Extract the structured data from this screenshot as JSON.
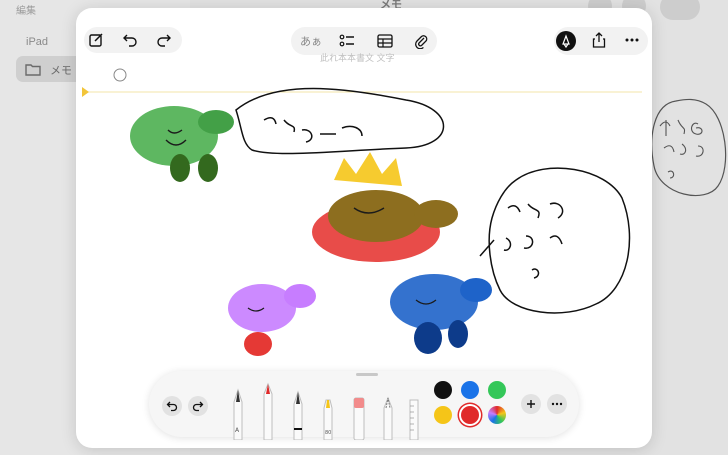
{
  "background": {
    "edit_label": "編集",
    "notes_title": "メモ",
    "device_label": "iPad",
    "folder_label": "メモ"
  },
  "toolbar": {
    "text_format_label": "あぁ",
    "text_hint": "此れ本本書文 文字"
  },
  "palette": {
    "colors": [
      "#111111",
      "#1a73e8",
      "#34c759",
      "#f5c518",
      "#e02a2a",
      "rainbow"
    ],
    "selected_color": "#e02a2a"
  }
}
